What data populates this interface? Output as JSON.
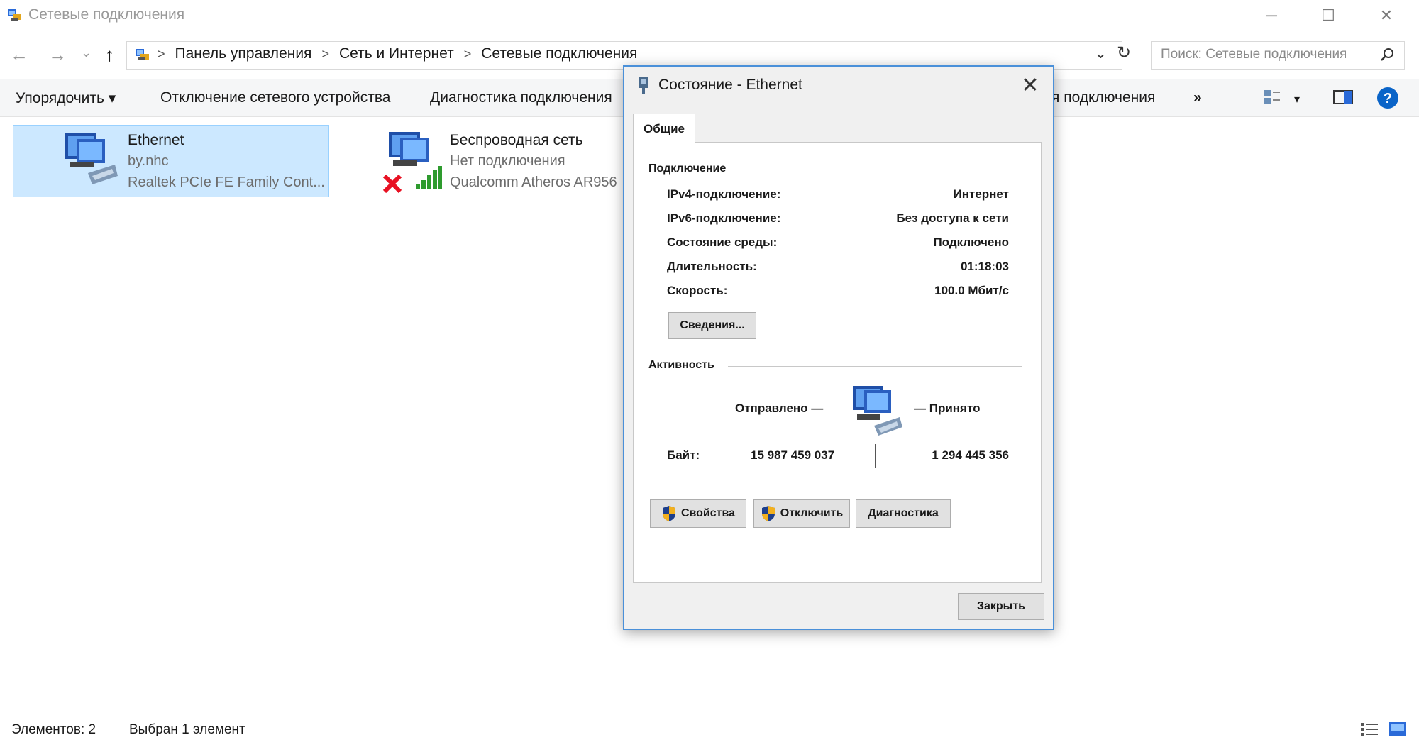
{
  "window": {
    "title": "Сетевые подключения",
    "minimize_glyph": "─",
    "maximize_glyph": "☐",
    "close_glyph": "✕"
  },
  "navigation": {
    "back_glyph": "←",
    "forward_glyph": "→",
    "recent_glyph": "⌄",
    "up_glyph": "↑",
    "breadcrumbs": [
      "Панель управления",
      "Сеть и Интернет",
      "Сетевые подключения"
    ],
    "breadcrumb_separator": ">",
    "dropdown_glyph": "⌄",
    "refresh_glyph": "↻",
    "search_placeholder": "Поиск: Сетевые подключения"
  },
  "toolbar": {
    "organize": "Упорядочить ▾",
    "disable_device": "Отключение сетевого устройства",
    "diagnose": "Диагностика подключения",
    "rename_partial": "я подключения",
    "more": "»",
    "view_arrow": "▾"
  },
  "connections": [
    {
      "name": "Ethernet",
      "status": "by.nhc",
      "adapter": "Realtek PCIe FE Family Cont...",
      "selected": true
    },
    {
      "name": "Беспроводная сеть",
      "status": "Нет подключения",
      "adapter": "Qualcomm Atheros AR956",
      "selected": false
    }
  ],
  "statusbar": {
    "items_count": "Элементов: 2",
    "selected": "Выбран 1 элемент"
  },
  "dialog": {
    "title": "Состояние - Ethernet",
    "close_glyph": "✕",
    "tab": "Общие",
    "connection_section": "Подключение",
    "rows": [
      {
        "label": "IPv4-подключение:",
        "value": "Интернет"
      },
      {
        "label": "IPv6-подключение:",
        "value": "Без доступа к сети"
      },
      {
        "label": "Состояние среды:",
        "value": "Подключено"
      },
      {
        "label": "Длительность:",
        "value": "01:18:03"
      },
      {
        "label": "Скорость:",
        "value": "100.0 Мбит/с"
      }
    ],
    "details_button": "Сведения...",
    "activity_section": "Активность",
    "sent_label": "Отправлено —",
    "received_label": "— Принято",
    "bytes_label": "Байт:",
    "bytes_sent": "15 987 459 037",
    "bytes_received": "1 294 445 356",
    "properties_button": "Свойства",
    "disable_button": "Отключить",
    "diagnose_button": "Диагностика",
    "close_button": "Закрыть"
  },
  "colors": {
    "selection_bg": "#cce8ff",
    "selection_border": "#99d1ff",
    "dialog_border": "#4a90d9",
    "help_icon": "#0a64c8",
    "error_x": "#e81123",
    "signal_bars": "#2e9b2e"
  }
}
